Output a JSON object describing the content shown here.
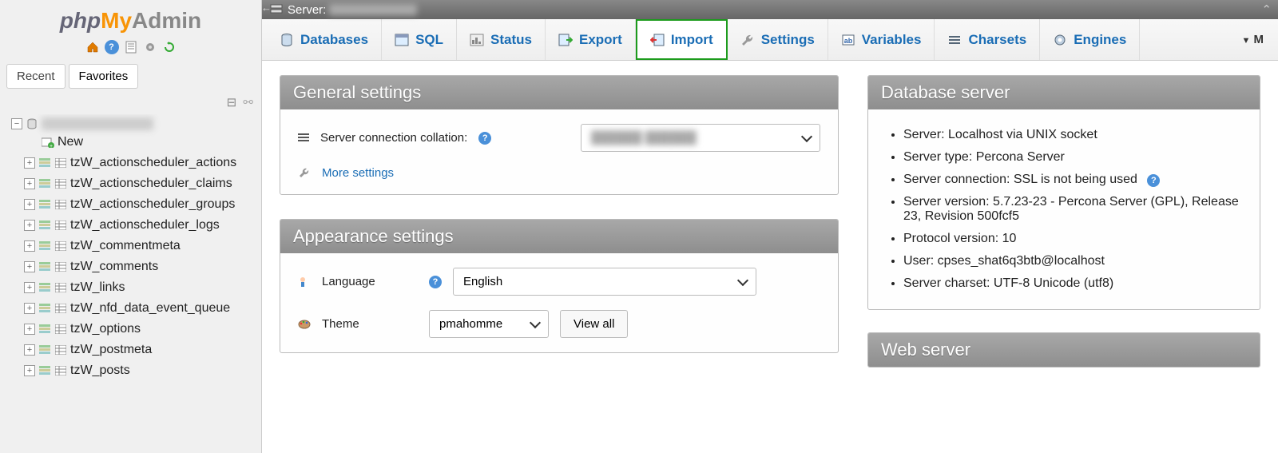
{
  "logo": {
    "part1": "php",
    "part2": "My",
    "part3": "Admin"
  },
  "sidebar": {
    "recent_label": "Recent",
    "favorites_label": "Favorites",
    "new_label": "New",
    "tables": [
      "tzW_actionscheduler_actions",
      "tzW_actionscheduler_claims",
      "tzW_actionscheduler_groups",
      "tzW_actionscheduler_logs",
      "tzW_commentmeta",
      "tzW_comments",
      "tzW_links",
      "tzW_nfd_data_event_queue",
      "tzW_options",
      "tzW_postmeta",
      "tzW_posts"
    ]
  },
  "topbar": {
    "server_label": "Server:"
  },
  "tabs": [
    {
      "label": "Databases",
      "icon": "database-icon"
    },
    {
      "label": "SQL",
      "icon": "sql-icon"
    },
    {
      "label": "Status",
      "icon": "status-icon"
    },
    {
      "label": "Export",
      "icon": "export-icon"
    },
    {
      "label": "Import",
      "icon": "import-icon",
      "selected": true
    },
    {
      "label": "Settings",
      "icon": "settings-icon"
    },
    {
      "label": "Variables",
      "icon": "variables-icon"
    },
    {
      "label": "Charsets",
      "icon": "charsets-icon"
    },
    {
      "label": "Engines",
      "icon": "engines-icon"
    }
  ],
  "tab_more": "M",
  "panels": {
    "general": {
      "title": "General settings",
      "collation_label": "Server connection collation:",
      "collation_value": "██████ ██████",
      "more_settings": "More settings"
    },
    "appearance": {
      "title": "Appearance settings",
      "language_label": "Language",
      "language_value": "English",
      "theme_label": "Theme",
      "theme_value": "pmahomme",
      "view_all": "View all"
    },
    "db_server": {
      "title": "Database server",
      "items": [
        "Server: Localhost via UNIX socket",
        "Server type: Percona Server",
        "Server connection: SSL is not being used",
        "Server version: 5.7.23-23 - Percona Server (GPL), Release 23, Revision 500fcf5",
        "Protocol version: 10",
        "User: cpses_shat6q3btb@localhost",
        "Server charset: UTF-8 Unicode (utf8)"
      ]
    },
    "web_server": {
      "title": "Web server"
    }
  }
}
